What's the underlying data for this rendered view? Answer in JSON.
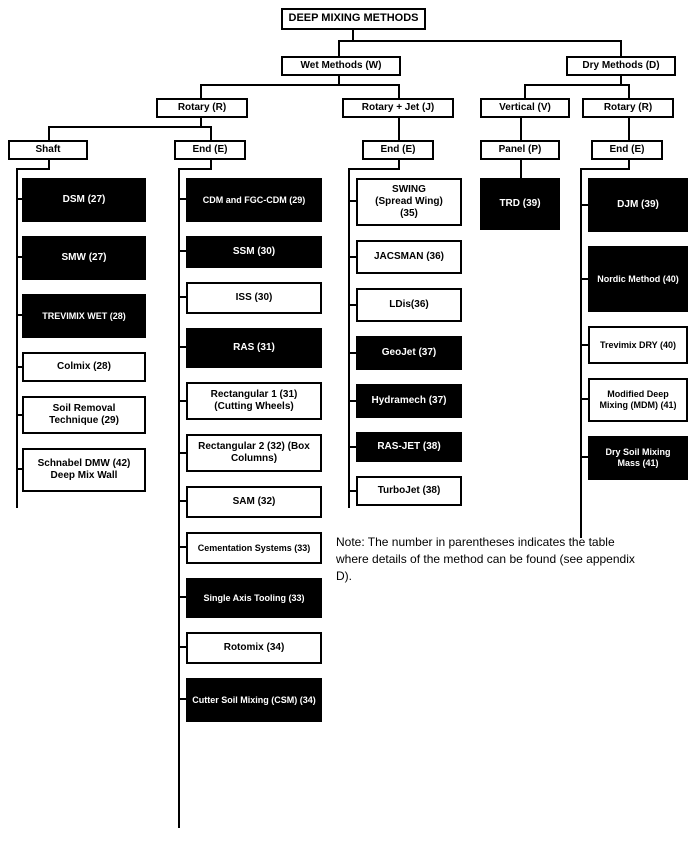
{
  "title": "DEEP MIXING METHODS",
  "l1": {
    "wet": "Wet Methods (W)",
    "dry": "Dry Methods (D)"
  },
  "l2": {
    "wet_rotary": "Rotary (R)",
    "wet_rj": "Rotary + Jet (J)",
    "dry_vertical": "Vertical (V)",
    "dry_rotary": "Rotary (R)"
  },
  "l3": {
    "shaft": "Shaft",
    "wet_end": "End (E)",
    "rj_end": "End (E)",
    "panel": "Panel (P)",
    "dry_end": "End (E)"
  },
  "shaft": {
    "a": "DSM (27)",
    "b": "SMW (27)",
    "c": "TREVIMIX WET (28)",
    "d": "Colmix (28)",
    "e": "Soil Removal Technique (29)",
    "f": "Schnabel DMW (42)\nDeep Mix Wall"
  },
  "wet_end": {
    "a": "CDM and FGC-CDM (29)",
    "b": "SSM (30)",
    "c": "ISS (30)",
    "d": "RAS (31)",
    "e": "Rectangular 1 (31) (Cutting Wheels)",
    "f": "Rectangular 2 (32) (Box Columns)",
    "g": "SAM (32)",
    "h": "Cementation Systems (33)",
    "i": "Single Axis Tooling (33)",
    "j": "Rotomix   (34)",
    "k": "Cutter Soil Mixing (CSM) (34)"
  },
  "rj_end": {
    "a": "SWING\n(Spread Wing)\n(35)",
    "b": "JACSMAN (36)",
    "c": "LDis(36)",
    "d": "GeoJet (37)",
    "e": "Hydramech (37)",
    "f": "RAS-JET (38)",
    "g": "TurboJet (38)"
  },
  "panel": {
    "a": "TRD (39)"
  },
  "dry_end": {
    "a": "DJM (39)",
    "b": "Nordic Method (40)",
    "c": "Trevimix DRY (40)",
    "d": "Modified Deep Mixing (MDM) (41)",
    "e": "Dry Soil Mixing Mass (41)"
  },
  "note": "Note: The number in parentheses indicates the table where details of the method can be found (see appendix D)."
}
